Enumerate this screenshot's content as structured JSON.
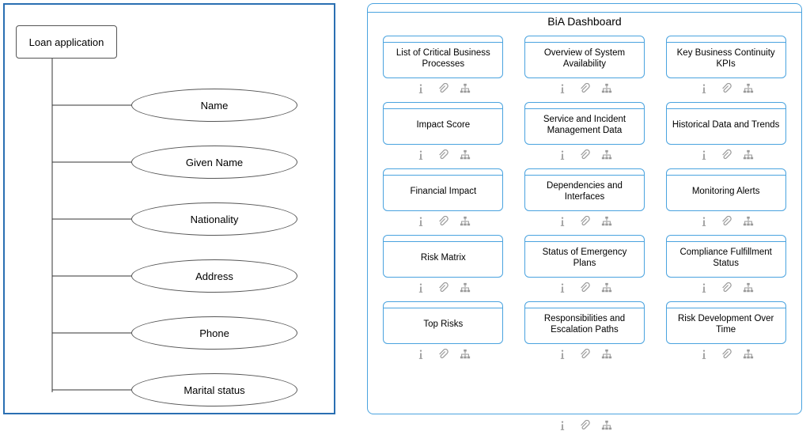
{
  "left": {
    "root": "Loan application",
    "attributes": [
      "Name",
      "Given Name",
      "Nationality",
      "Address",
      "Phone",
      "Marital status"
    ]
  },
  "right": {
    "title": "BiA Dashboard",
    "cards": [
      "List of Critical Business Processes",
      "Overview of System Availability",
      "Key Business Continuity KPIs",
      "Impact Score",
      "Service and Incident Management Data",
      "Historical Data and Trends",
      "Financial Impact",
      "Dependencies and Interfaces",
      "Monitoring Alerts",
      "Risk Matrix",
      "Status of Emergency Plans",
      "Compliance Fulfillment Status",
      "Top Risks",
      "Responsibilities and Escalation Paths",
      "Risk Development Over Time"
    ],
    "icons": [
      "info-icon",
      "attachment-icon",
      "hierarchy-icon"
    ]
  }
}
